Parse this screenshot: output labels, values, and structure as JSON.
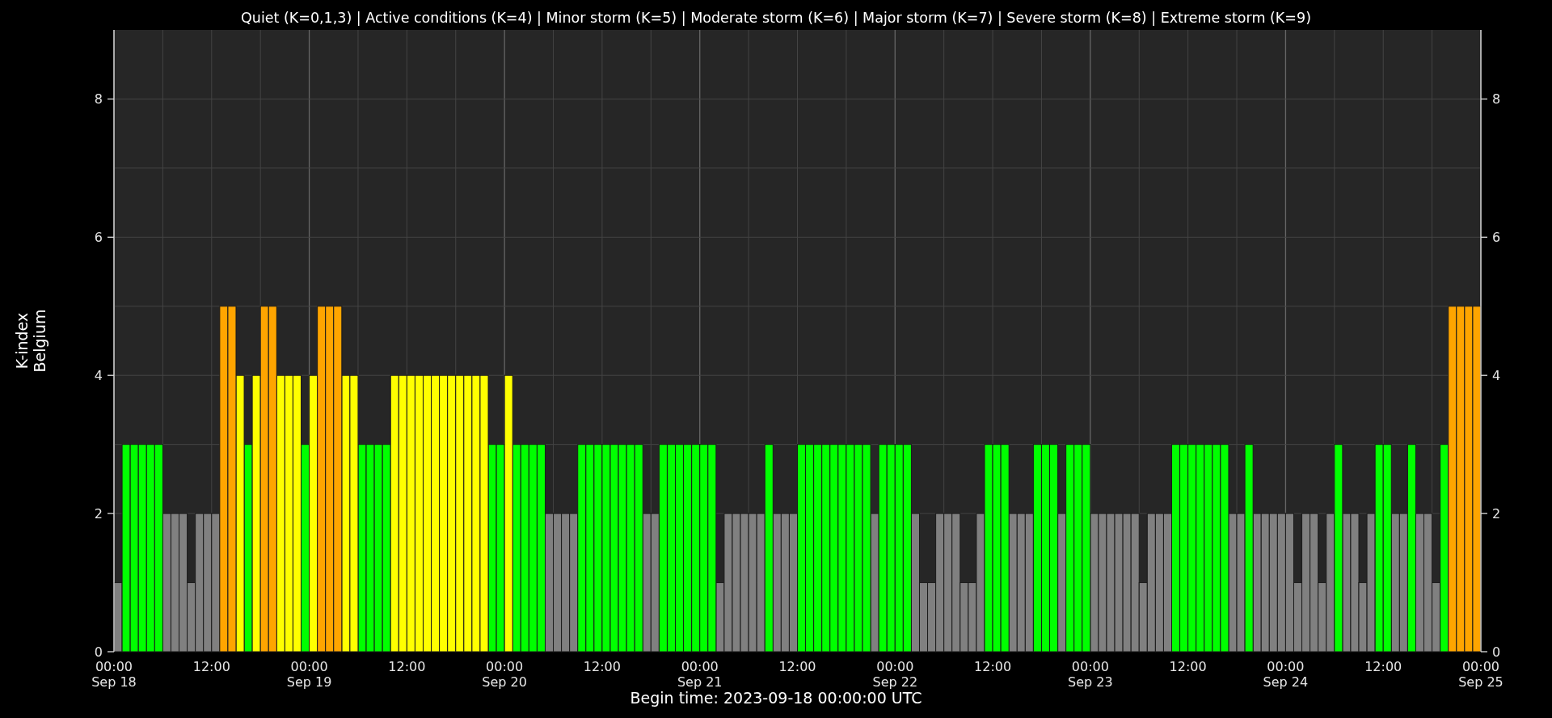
{
  "chart_data": {
    "type": "bar",
    "title": "Quiet (K=0,1,3) | Active conditions (K=4) | Minor storm (K=5) | Moderate storm (K=6) | Major storm (K=7) | Severe storm (K=8) | Extreme storm (K=9)",
    "xlabel": "Begin time: 2023-09-18 00:00:00 UTC",
    "ylabel": "K-index\nBelgium",
    "grid": true,
    "ylim": [
      0,
      9
    ],
    "yticks": [
      0,
      2,
      4,
      6,
      8
    ],
    "y2lim": [
      0,
      9
    ],
    "y2ticks": [
      0,
      2,
      4,
      6,
      8
    ],
    "categories": [
      "00:00\nSep 18",
      null,
      null,
      null,
      null,
      null,
      null,
      null,
      null,
      null,
      null,
      null,
      "12:00",
      null,
      null,
      null,
      null,
      null,
      null,
      null,
      null,
      null,
      null,
      null,
      "00:00\nSep 19",
      null,
      null,
      null,
      null,
      null,
      null,
      null,
      null,
      null,
      null,
      null,
      "12:00",
      null,
      null,
      null,
      null,
      null,
      null,
      null,
      null,
      null,
      null,
      null,
      "00:00\nSep 20",
      null,
      null,
      null,
      null,
      null,
      null,
      null,
      null,
      null,
      null,
      null,
      "12:00",
      null,
      null,
      null,
      null,
      null,
      null,
      null,
      null,
      null,
      null,
      null,
      "00:00\nSep 21",
      null,
      null,
      null,
      null,
      null,
      null,
      null,
      null,
      null,
      null,
      null,
      "12:00",
      null,
      null,
      null,
      null,
      null,
      null,
      null,
      null,
      null,
      null,
      null,
      "00:00\nSep 22",
      null,
      null,
      null,
      null,
      null,
      null,
      null,
      null,
      null,
      null,
      null,
      "12:00",
      null,
      null,
      null,
      null,
      null,
      null,
      null,
      null,
      null,
      null,
      null,
      "00:00\nSep 23",
      null,
      null,
      null,
      null,
      null,
      null,
      null,
      null,
      null,
      null,
      null,
      "12:00",
      null,
      null,
      null,
      null,
      null,
      null,
      null,
      null,
      null,
      null,
      null,
      "00:00\nSep 24",
      null,
      null,
      null,
      null,
      null,
      null,
      null,
      null,
      null,
      null,
      null,
      "12:00",
      null,
      null,
      null,
      null,
      null,
      null,
      null,
      null,
      null,
      null,
      null,
      "00:00\nSep 25"
    ],
    "series": [
      {
        "color": "#808080",
        "values": [
          1,
          null,
          null,
          null,
          null,
          null,
          2,
          2,
          2,
          1,
          2,
          2,
          2,
          null,
          null,
          null,
          null,
          null,
          null,
          null,
          null,
          null,
          null,
          null,
          null,
          null,
          null,
          null,
          null,
          null,
          null,
          null,
          null,
          null,
          null,
          null,
          null,
          null,
          null,
          null,
          null,
          null,
          null,
          null,
          null,
          null,
          null,
          null,
          null,
          null,
          null,
          null,
          null,
          2,
          2,
          2,
          2,
          null,
          null,
          null,
          null,
          null,
          null,
          null,
          null,
          2,
          2,
          null,
          null,
          null,
          null,
          null,
          null,
          null,
          1,
          2,
          2,
          2,
          2,
          2,
          null,
          2,
          2,
          2,
          null,
          null,
          null,
          null,
          null,
          null,
          null,
          null,
          null,
          2,
          null,
          null,
          null,
          null,
          2,
          1,
          1,
          2,
          2,
          2,
          1,
          1,
          2,
          null,
          null,
          null,
          2,
          2,
          2,
          null,
          null,
          null,
          2,
          null,
          null,
          null,
          2,
          2,
          2,
          2,
          2,
          2,
          1,
          2,
          2,
          2,
          null,
          null,
          null,
          null,
          null,
          null,
          null,
          2,
          2,
          null,
          2,
          2,
          2,
          2,
          2,
          1,
          2,
          2,
          1,
          2,
          null,
          2,
          2,
          1,
          2,
          null,
          null,
          2,
          2,
          null,
          2,
          2,
          1,
          null,
          null,
          null,
          null,
          null,
          null
        ]
      },
      {
        "color": "#00ff00",
        "values": [
          null,
          3,
          3,
          3,
          3,
          3,
          null,
          null,
          null,
          null,
          null,
          null,
          null,
          null,
          null,
          null,
          3,
          null,
          null,
          null,
          null,
          null,
          null,
          3,
          null,
          null,
          null,
          null,
          null,
          null,
          3,
          3,
          3,
          3,
          null,
          null,
          null,
          null,
          null,
          null,
          null,
          null,
          null,
          null,
          null,
          null,
          3,
          3,
          null,
          3,
          3,
          3,
          3,
          null,
          null,
          null,
          null,
          3,
          3,
          3,
          3,
          3,
          3,
          3,
          3,
          null,
          null,
          3,
          3,
          3,
          3,
          3,
          3,
          3,
          null,
          null,
          null,
          null,
          null,
          null,
          3,
          null,
          null,
          null,
          3,
          3,
          3,
          3,
          3,
          3,
          3,
          3,
          3,
          null,
          3,
          3,
          3,
          3,
          null,
          null,
          null,
          null,
          null,
          null,
          null,
          null,
          null,
          3,
          3,
          3,
          null,
          null,
          null,
          3,
          3,
          3,
          null,
          3,
          3,
          3,
          null,
          null,
          null,
          null,
          null,
          null,
          null,
          null,
          null,
          null,
          3,
          3,
          3,
          3,
          3,
          3,
          3,
          null,
          null,
          3,
          null,
          null,
          null,
          null,
          null,
          null,
          null,
          null,
          null,
          null,
          3,
          null,
          null,
          null,
          null,
          3,
          3,
          null,
          null,
          3,
          null,
          null,
          null,
          3,
          null,
          null,
          null,
          null,
          null
        ]
      },
      {
        "color": "#ffff00",
        "values": [
          null,
          null,
          null,
          null,
          null,
          null,
          null,
          null,
          null,
          null,
          null,
          null,
          null,
          null,
          null,
          4,
          null,
          4,
          null,
          null,
          4,
          4,
          4,
          null,
          4,
          null,
          null,
          null,
          4,
          4,
          null,
          null,
          null,
          null,
          4,
          4,
          4,
          4,
          4,
          4,
          4,
          4,
          4,
          4,
          4,
          4,
          null,
          null,
          4,
          null,
          null,
          null,
          null,
          null,
          null,
          null,
          null,
          null,
          null,
          null,
          null,
          null,
          null,
          null,
          null,
          null,
          null,
          null,
          null,
          null,
          null,
          null,
          null,
          null,
          null,
          null,
          null,
          null,
          null,
          null,
          null,
          null,
          null,
          null,
          null,
          null,
          null,
          null,
          null,
          null,
          null,
          null,
          null,
          null,
          null,
          null,
          null,
          null,
          null,
          null,
          null,
          null,
          null,
          null,
          null,
          null,
          null,
          null,
          null,
          null,
          null,
          null,
          null,
          null,
          null,
          null,
          null,
          null,
          null,
          null,
          null,
          null,
          null,
          null,
          null,
          null,
          null,
          null,
          null,
          null,
          null,
          null,
          null,
          null,
          null,
          null,
          null,
          null,
          null,
          null,
          null,
          null,
          null,
          null,
          null,
          null,
          null,
          null,
          null,
          null,
          null,
          null,
          null,
          null,
          null,
          null,
          null,
          null,
          null,
          null,
          null,
          null,
          null,
          null,
          null,
          null,
          null,
          null,
          null
        ]
      },
      {
        "color": "#ffa500",
        "values": [
          null,
          null,
          null,
          null,
          null,
          null,
          null,
          null,
          null,
          null,
          null,
          null,
          null,
          5,
          5,
          null,
          null,
          null,
          5,
          5,
          null,
          null,
          null,
          null,
          null,
          5,
          5,
          5,
          null,
          null,
          null,
          null,
          null,
          null,
          null,
          null,
          null,
          null,
          null,
          null,
          null,
          null,
          null,
          null,
          null,
          null,
          null,
          null,
          null,
          null,
          null,
          null,
          null,
          null,
          null,
          null,
          null,
          null,
          null,
          null,
          null,
          null,
          null,
          null,
          null,
          null,
          null,
          null,
          null,
          null,
          null,
          null,
          null,
          null,
          null,
          null,
          null,
          null,
          null,
          null,
          null,
          null,
          null,
          null,
          null,
          null,
          null,
          null,
          null,
          null,
          null,
          null,
          null,
          null,
          null,
          null,
          null,
          null,
          null,
          null,
          null,
          null,
          null,
          null,
          null,
          null,
          null,
          null,
          null,
          null,
          null,
          null,
          null,
          null,
          null,
          null,
          null,
          null,
          null,
          null,
          null,
          null,
          null,
          null,
          null,
          null,
          null,
          null,
          null,
          null,
          null,
          null,
          null,
          null,
          null,
          null,
          null,
          null,
          null,
          null,
          null,
          null,
          null,
          null,
          null,
          null,
          null,
          null,
          null,
          null,
          null,
          null,
          null,
          null,
          null,
          null,
          null,
          null,
          null,
          null,
          null,
          null,
          null,
          null,
          5,
          5,
          5,
          5,
          null
        ]
      }
    ]
  }
}
